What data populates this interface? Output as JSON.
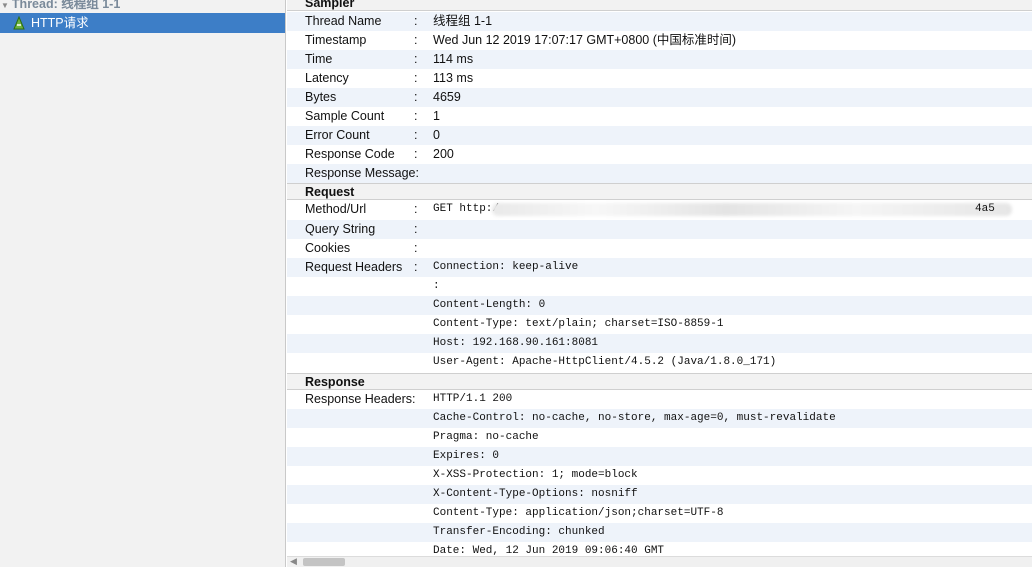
{
  "tree": {
    "root_label": "Thread: 线程组 1-1",
    "selected_label": "HTTP请求",
    "selected_icon": "pipette-icon"
  },
  "sampler": {
    "header": "Sampler",
    "rows": [
      {
        "key": "Thread Name",
        "sep": ":",
        "value": "线程组 1-1"
      },
      {
        "key": "Timestamp",
        "sep": ":",
        "value": "Wed Jun 12 2019 17:07:17 GMT+0800 (中国标准时间)"
      },
      {
        "key": "Time",
        "sep": ":",
        "value": "114 ms"
      },
      {
        "key": "Latency",
        "sep": ":",
        "value": "113 ms"
      },
      {
        "key": "Bytes",
        "sep": ":",
        "value": "4659"
      },
      {
        "key": "Sample Count",
        "sep": ":",
        "value": "1"
      },
      {
        "key": "Error Count",
        "sep": ":",
        "value": "0"
      },
      {
        "key": "Response Code",
        "sep": ":",
        "value": "200"
      },
      {
        "key": "Response Message:",
        "sep": "",
        "value": ""
      }
    ]
  },
  "request": {
    "header": "Request",
    "method_url": {
      "key": "Method/Url",
      "sep": ":",
      "value": "GET http:/",
      "tail": "4a5"
    },
    "query_string": {
      "key": "Query String",
      "sep": ":",
      "value": ""
    },
    "cookies": {
      "key": "Cookies",
      "sep": ":",
      "value": ""
    },
    "headers_key": "Request Headers",
    "headers_sep": ":",
    "headers": [
      "Connection: keep-alive",
      ":",
      "Content-Length: 0",
      "Content-Type: text/plain; charset=ISO-8859-1",
      "Host: 192.168.90.161:8081",
      "User-Agent: Apache-HttpClient/4.5.2 (Java/1.8.0_171)"
    ]
  },
  "response": {
    "header": "Response",
    "headers_key": "Response Headers:",
    "headers": [
      "HTTP/1.1 200",
      "Cache-Control: no-cache, no-store, max-age=0, must-revalidate",
      "Pragma: no-cache",
      "Expires: 0",
      "X-XSS-Protection: 1; mode=block",
      "X-Content-Type-Options: nosniff",
      "Content-Type: application/json;charset=UTF-8",
      "Transfer-Encoding: chunked",
      "Date: Wed, 12 Jun 2019 09:06:40 GMT"
    ]
  },
  "colors": {
    "selection": "#3d7ec7",
    "alt_row": "#eef3fa",
    "panel": "#f2f2f2"
  }
}
